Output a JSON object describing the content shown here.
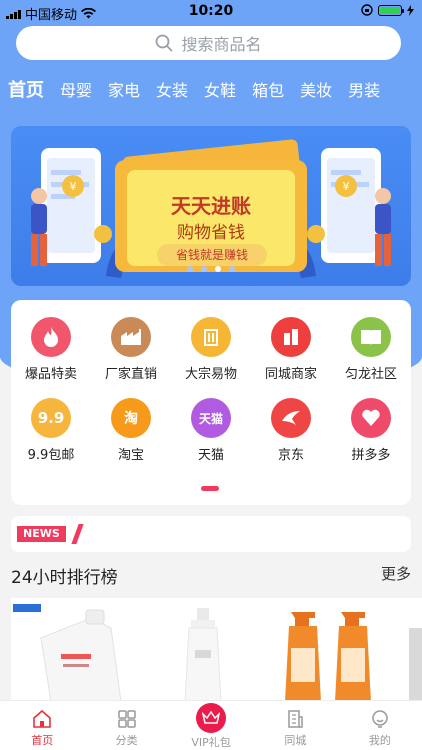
{
  "status_bar": {
    "carrier": "中国移动",
    "time": "10:20"
  },
  "search": {
    "placeholder": "搜索商品名"
  },
  "tabs": [
    "首页",
    "母婴",
    "家电",
    "女装",
    "女鞋",
    "箱包",
    "美妆",
    "男装"
  ],
  "banner": {
    "headline": "天天进账",
    "subline": "购物省钱",
    "pill": "省钱就是赚钱",
    "dots_total": 4,
    "dots_active_index": 2
  },
  "categories": [
    {
      "label": "爆品特卖",
      "icon": "fire-icon",
      "color": "#f2566d"
    },
    {
      "label": "厂家直销",
      "icon": "factory-icon",
      "color": "#c98a58"
    },
    {
      "label": "大宗易物",
      "icon": "building-icon",
      "color": "#f4b634"
    },
    {
      "label": "同城商家",
      "icon": "city-building-icon",
      "color": "#ef3e3e"
    },
    {
      "label": "匀龙社区",
      "icon": "book-icon",
      "color": "#8bc34a"
    },
    {
      "label": "9.9包邮",
      "icon": "nine-nine-icon",
      "color": "#f6b53d"
    },
    {
      "label": "淘宝",
      "icon": "taobao-icon",
      "color": "#f79a1c"
    },
    {
      "label": "天猫",
      "icon": "tmall-icon",
      "color": "#b15ce0"
    },
    {
      "label": "京东",
      "icon": "jd-icon",
      "color": "#ef4545"
    },
    {
      "label": "拼多多",
      "icon": "pinduoduo-icon",
      "color": "#f04a6a"
    }
  ],
  "news": {
    "badge": "NEWS"
  },
  "ranking": {
    "title": "24小时排行榜",
    "more": "更多"
  },
  "tabbar": [
    {
      "label": "首页",
      "icon": "home-icon",
      "active": true
    },
    {
      "label": "分类",
      "icon": "grid-icon",
      "active": false
    },
    {
      "label": "VIP礼包",
      "icon": "crown-icon",
      "active": false
    },
    {
      "label": "同城",
      "icon": "building-icon",
      "active": false
    },
    {
      "label": "我的",
      "icon": "profile-icon",
      "active": false
    }
  ],
  "colors": {
    "brand_blue": "#6ea4f7",
    "accent_red": "#ee3b5e",
    "tab_active": "#e6323c"
  }
}
